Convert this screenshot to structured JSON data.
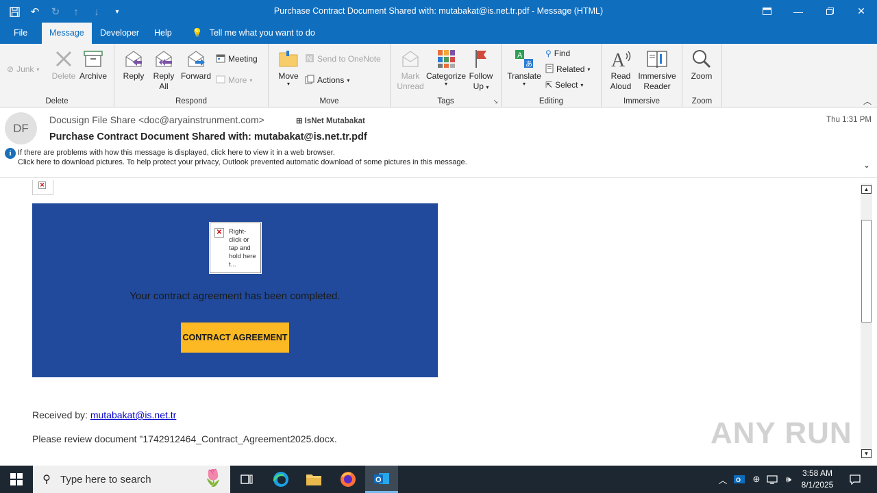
{
  "window": {
    "title": "Purchase Contract Document Shared with: mutabakat@is.net.tr.pdf  -  Message (HTML)"
  },
  "tabs": [
    {
      "label": "File"
    },
    {
      "label": "Message"
    },
    {
      "label": "Developer"
    },
    {
      "label": "Help"
    }
  ],
  "tell_me": "Tell me what you want to do",
  "ribbon": {
    "delete_group": {
      "label": "Delete",
      "junk": "Junk",
      "delete": "Delete",
      "archive": "Archive"
    },
    "respond_group": {
      "label": "Respond",
      "reply": "Reply",
      "reply_all_1": "Reply",
      "reply_all_2": "All",
      "forward": "Forward",
      "meeting": "Meeting",
      "more": "More"
    },
    "move_group": {
      "label": "Move",
      "move": "Move",
      "send_onenote": "Send to OneNote",
      "actions": "Actions"
    },
    "tags_group": {
      "label": "Tags",
      "mark_1": "Mark",
      "mark_2": "Unread",
      "categorize": "Categorize",
      "follow_1": "Follow",
      "follow_2": "Up"
    },
    "editing_group": {
      "label": "Editing",
      "translate": "Translate",
      "find": "Find",
      "related": "Related",
      "select": "Select"
    },
    "immersive_group": {
      "label": "Immersive",
      "read_1": "Read",
      "read_2": "Aloud",
      "immersive_1": "Immersive",
      "immersive_2": "Reader"
    },
    "zoom_group": {
      "label": "Zoom",
      "zoom": "Zoom"
    }
  },
  "message": {
    "avatar_initials": "DF",
    "sender": "Docusign File Share <doc@aryainstrunment.com>",
    "recipient": "IsNet Mutabakat",
    "subject": "Purchase Contract Document Shared with: mutabakat@is.net.tr.pdf",
    "date": "Thu 1:31 PM",
    "info_line_1": "If there are problems with how this message is displayed, click here to view it in a web browser.",
    "info_line_2": "Click here to download pictures. To help protect your privacy, Outlook prevented automatic download of some pictures in this message."
  },
  "body": {
    "image_placeholder_text": "Right-click or tap and hold here t...",
    "completed_text": "Your contract agreement has been completed.",
    "button_label": "CONTRACT AGREEMENT",
    "received_by_label": "Received by: ",
    "received_by_email": "mutabakat@is.net.tr",
    "review_text": "Please review document \"1742912464_Contract_Agreement2025.docx."
  },
  "watermark": "ANY RUN",
  "taskbar": {
    "search_placeholder": "Type here to search",
    "time": "3:58 AM",
    "date": "8/1/2025"
  },
  "colors": {
    "titlebar": "#106ebe",
    "card_background": "#214a9c",
    "button_background": "#fcb924",
    "taskbar": "#1c2731"
  }
}
